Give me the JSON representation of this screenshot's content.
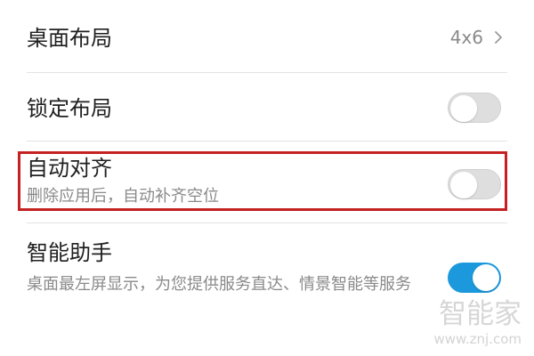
{
  "settings": {
    "desktop_layout": {
      "label": "桌面布局",
      "value": "4x6",
      "chevron_icon": "chevron-right-icon"
    },
    "lock_layout": {
      "label": "锁定布局",
      "toggle_state": "off"
    },
    "auto_align": {
      "label": "自动对齐",
      "description": "删除应用后，自动补齐空位",
      "toggle_state": "off",
      "highlight_color": "#c42222"
    },
    "smart_assistant": {
      "label": "智能助手",
      "description": "桌面最左屏显示，为您提供服务直达、情景智能等服务",
      "toggle_state": "on",
      "toggle_color": "#1c98dc"
    }
  },
  "watermark": {
    "brand": "智能家",
    "domain": "www.znj.com"
  }
}
